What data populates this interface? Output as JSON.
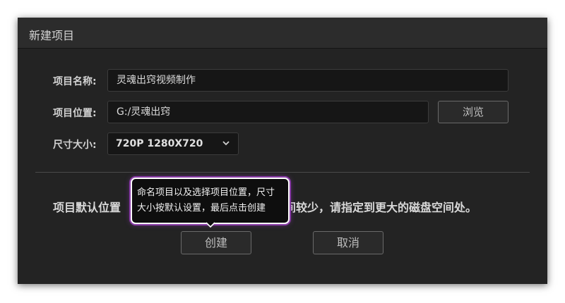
{
  "dialog": {
    "title": "新建项目",
    "fields": {
      "name_label": "项目名称:",
      "name_value": "灵魂出窍视频制作",
      "location_label": "项目位置:",
      "location_value": "G:/灵魂出窍",
      "browse_label": "浏览",
      "size_label": "尺寸大小:",
      "size_value": "720P 1280X720"
    },
    "hint": {
      "prefix": "项目默认位置",
      "suffix": "空间较少，请指定到更大的磁盘空间处。"
    },
    "buttons": {
      "create_label": "创建",
      "cancel_label": "取消"
    },
    "tooltip": {
      "line1": "命名项目以及选择项目位置，尺寸",
      "line2": "大小按默认设置，最后点击创建"
    },
    "icons": {
      "dropdown": "chevron-down-icon"
    },
    "colors": {
      "background": "#232323",
      "tooltip_glow": "#8a3ca8"
    }
  }
}
